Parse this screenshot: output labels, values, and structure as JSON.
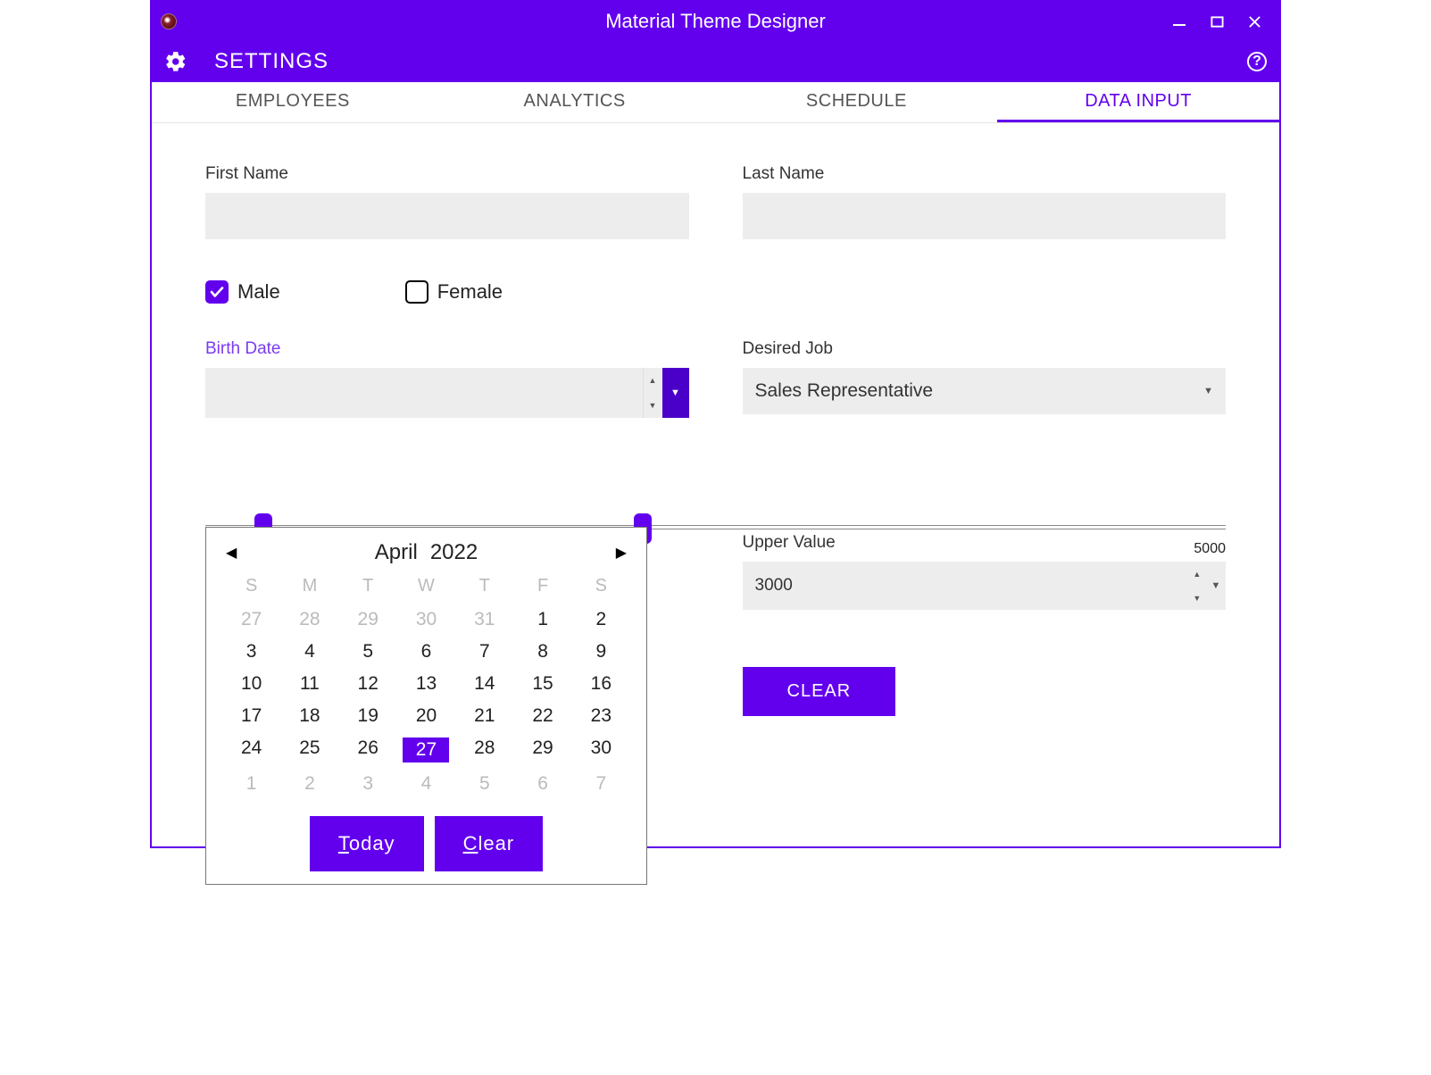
{
  "window": {
    "title": "Material Theme Designer"
  },
  "settings": {
    "label": "SETTINGS"
  },
  "tabs": [
    {
      "label": "EMPLOYEES",
      "active": false
    },
    {
      "label": "ANALYTICS",
      "active": false
    },
    {
      "label": "SCHEDULE",
      "active": false
    },
    {
      "label": "DATA INPUT",
      "active": true
    }
  ],
  "form": {
    "first_name": {
      "label": "First Name",
      "value": ""
    },
    "last_name": {
      "label": "Last Name",
      "value": ""
    },
    "gender": {
      "male": {
        "label": "Male",
        "checked": true
      },
      "female": {
        "label": "Female",
        "checked": false
      }
    },
    "birth_date": {
      "label": "Birth Date",
      "value": ""
    },
    "desired_job": {
      "label": "Desired Job",
      "value": "Sales Representative"
    },
    "salary_slider": {
      "min": 1500,
      "max": 5000,
      "lower": 1700,
      "upper": 3000,
      "max_label": "5000"
    },
    "upper_value": {
      "label": "Upper Value",
      "value": "3000"
    },
    "clear_button": "CLEAR"
  },
  "calendar": {
    "month": "April",
    "year": "2022",
    "dow": [
      "S",
      "M",
      "T",
      "W",
      "T",
      "F",
      "S"
    ],
    "grid": [
      {
        "d": "27",
        "other": true
      },
      {
        "d": "28",
        "other": true
      },
      {
        "d": "29",
        "other": true
      },
      {
        "d": "30",
        "other": true
      },
      {
        "d": "31",
        "other": true
      },
      {
        "d": "1"
      },
      {
        "d": "2"
      },
      {
        "d": "3"
      },
      {
        "d": "4"
      },
      {
        "d": "5"
      },
      {
        "d": "6"
      },
      {
        "d": "7"
      },
      {
        "d": "8"
      },
      {
        "d": "9"
      },
      {
        "d": "10"
      },
      {
        "d": "11"
      },
      {
        "d": "12"
      },
      {
        "d": "13"
      },
      {
        "d": "14"
      },
      {
        "d": "15"
      },
      {
        "d": "16"
      },
      {
        "d": "17"
      },
      {
        "d": "18"
      },
      {
        "d": "19"
      },
      {
        "d": "20"
      },
      {
        "d": "21"
      },
      {
        "d": "22"
      },
      {
        "d": "23"
      },
      {
        "d": "24"
      },
      {
        "d": "25"
      },
      {
        "d": "26"
      },
      {
        "d": "27",
        "selected": true
      },
      {
        "d": "28"
      },
      {
        "d": "29"
      },
      {
        "d": "30"
      },
      {
        "d": "1",
        "other": true
      },
      {
        "d": "2",
        "other": true
      },
      {
        "d": "3",
        "other": true
      },
      {
        "d": "4",
        "other": true
      },
      {
        "d": "5",
        "other": true
      },
      {
        "d": "6",
        "other": true
      },
      {
        "d": "7",
        "other": true
      }
    ],
    "today_button": "Today",
    "clear_button": "Clear"
  }
}
